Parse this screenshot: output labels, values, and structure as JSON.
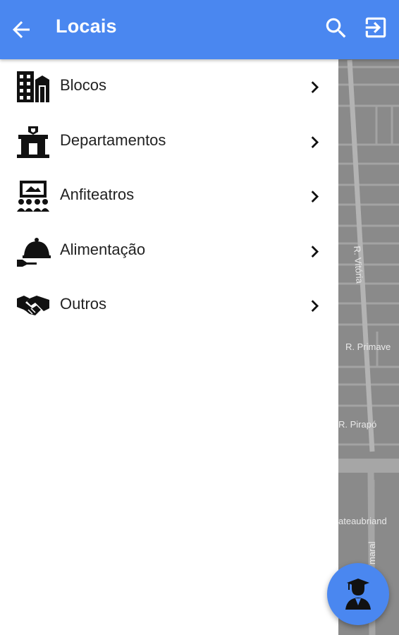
{
  "appbar": {
    "title": "Locais",
    "back_icon": "arrow-back-icon",
    "search_icon": "search-icon",
    "logout_icon": "exit-icon",
    "color": "#4a87f0"
  },
  "menu": {
    "items": [
      {
        "label": "Blocos",
        "icon": "buildings-icon"
      },
      {
        "label": "Departamentos",
        "icon": "department-icon"
      },
      {
        "label": "Anfiteatros",
        "icon": "auditorium-icon"
      },
      {
        "label": "Alimentação",
        "icon": "food-service-icon"
      },
      {
        "label": "Outros",
        "icon": "handshake-icon"
      }
    ]
  },
  "map": {
    "streets": [
      "R. Vitória",
      "R. Primave",
      "R. Pirapó",
      "ateaubriand",
      "maral"
    ]
  },
  "fab": {
    "icon": "graduate-icon"
  }
}
